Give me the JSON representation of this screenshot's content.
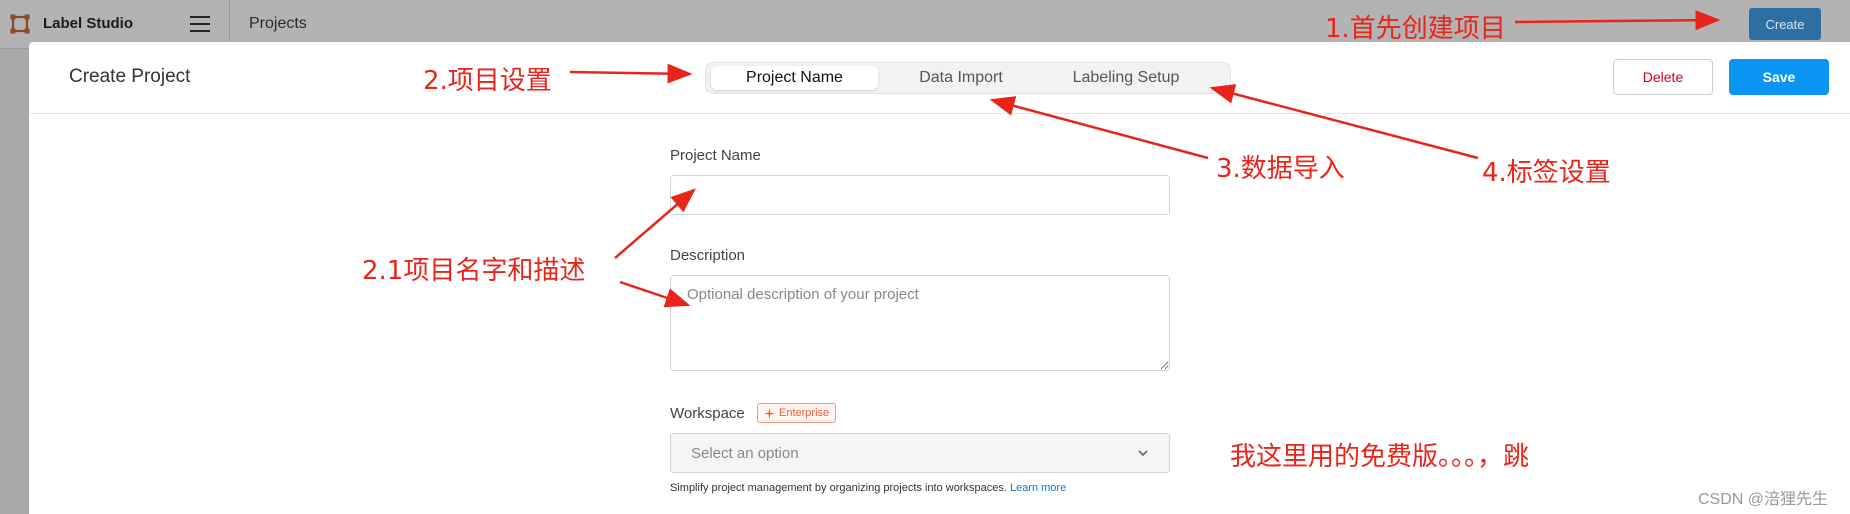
{
  "topbar": {
    "app_title": "Label Studio",
    "nav_projects": "Projects",
    "create_button": "Create",
    "icons": {
      "logo": "label-studio-logo",
      "menu": "hamburger-icon"
    }
  },
  "modal": {
    "title": "Create Project",
    "tabs": [
      {
        "label": "Project Name",
        "active": true
      },
      {
        "label": "Data Import",
        "active": false
      },
      {
        "label": "Labeling Setup",
        "active": false
      }
    ],
    "delete_button": "Delete",
    "save_button": "Save"
  },
  "form": {
    "project_name": {
      "label": "Project Name",
      "value": ""
    },
    "description": {
      "label": "Description",
      "placeholder": "Optional description of your project",
      "value": ""
    },
    "workspace": {
      "label": "Workspace",
      "badge": "Enterprise",
      "badge_icon": "sparkle-icon",
      "select_placeholder": "Select an option",
      "help_text": "Simplify project management by organizing projects into workspaces.",
      "help_link": "Learn more"
    }
  },
  "annotations": {
    "step1": "1.首先创建项目",
    "step2": "2.项目设置",
    "step21": "2.1项目名字和描述",
    "step3": "3.数据导入",
    "step4": "4.标签设置",
    "note": "我这里用的免费版。。。，跳",
    "color": "#e8251b"
  },
  "watermark": "CSDN @涪狸先生",
  "colors": {
    "save": "#0a95f2",
    "create": "#2d6ea3",
    "delete_text": "#d0021b",
    "badge": "#e4603f",
    "link": "#0a7bd6"
  }
}
